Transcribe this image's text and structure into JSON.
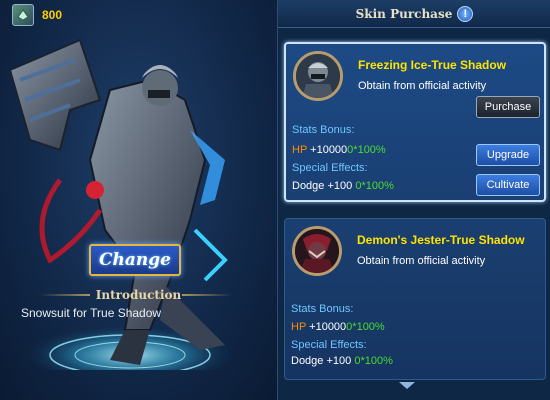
{
  "currency": {
    "icon": "gem-icon",
    "value": "800"
  },
  "character": {
    "change_label": "Change",
    "intro_title": "Introduction",
    "intro_text": "Snowsuit for True Shadow"
  },
  "panel": {
    "title": "Skin Purchase",
    "info_icon": "!"
  },
  "skins": [
    {
      "name": "Freezing Ice-True Shadow",
      "source": "Obtain from official activity",
      "stats_label": "Stats Bonus:",
      "stat_key": "HP",
      "stat_value": "+10000",
      "stat_mult": "0*100%",
      "effects_label": "Special Effects:",
      "effect_key": "Dodge",
      "effect_value": "+100",
      "effect_mult": "0*100%",
      "buttons": {
        "purchase": "Purchase",
        "upgrade": "Upgrade",
        "cultivate": "Cultivate"
      }
    },
    {
      "name": "Demon's Jester-True Shadow",
      "source": "Obtain from official activity",
      "stats_label": "Stats Bonus:",
      "stat_key": "HP",
      "stat_value": "+10000",
      "stat_mult": "0*100%",
      "effects_label": "Special Effects:",
      "effect_key": "Dodge",
      "effect_value": "+100",
      "effect_mult": "0*100%"
    }
  ],
  "colors": {
    "gold": "#ffe400",
    "accent_blue": "#6ec6ff",
    "hp_orange": "#ff8a00",
    "mult_green": "#4cdc2c"
  }
}
